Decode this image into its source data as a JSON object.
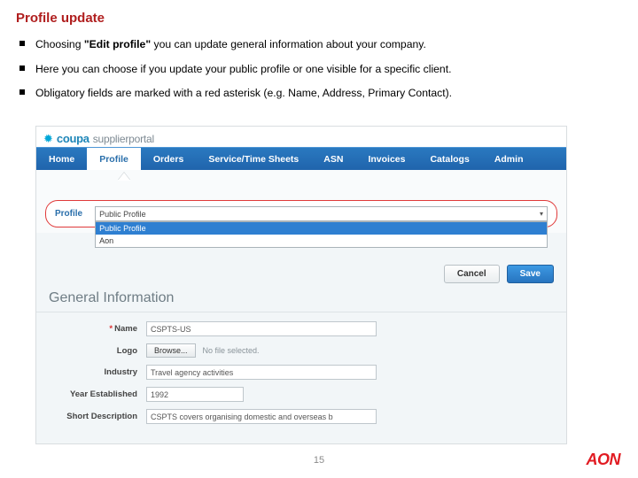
{
  "title": "Profile update",
  "bullets": [
    {
      "pre": "Choosing ",
      "bold": "\"Edit profile\"",
      "post": " you can update general information about your company."
    },
    {
      "pre": "Here you can choose if you update your public profile or one visible for a specific client.",
      "bold": "",
      "post": ""
    },
    {
      "pre": "Obligatory fields are marked with a red asterisk (e.g. Name, Address, Primary Contact).",
      "bold": "",
      "post": ""
    }
  ],
  "brand": {
    "coupa": "coupa",
    "sp": "supplierportal"
  },
  "nav": {
    "tabs": [
      "Home",
      "Profile",
      "Orders",
      "Service/Time Sheets",
      "ASN",
      "Invoices",
      "Catalogs",
      "Admin"
    ],
    "active": 1
  },
  "profileSelect": {
    "label": "Profile",
    "selected": "Public Profile",
    "options": [
      "Public Profile",
      "Aon"
    ]
  },
  "buttons": {
    "cancel": "Cancel",
    "save": "Save"
  },
  "section": "General Information",
  "fields": {
    "name": {
      "label": "Name",
      "value": "CSPTS-US",
      "required": true
    },
    "logo": {
      "label": "Logo",
      "browse": "Browse...",
      "note": "No file selected."
    },
    "industry": {
      "label": "Industry",
      "value": "Travel agency activities"
    },
    "year": {
      "label": "Year Established",
      "value": "1992"
    },
    "desc": {
      "label": "Short Description",
      "value": "CSPTS covers organising domestic and overseas b"
    }
  },
  "pageNumber": "15",
  "footerBrand": "AON"
}
